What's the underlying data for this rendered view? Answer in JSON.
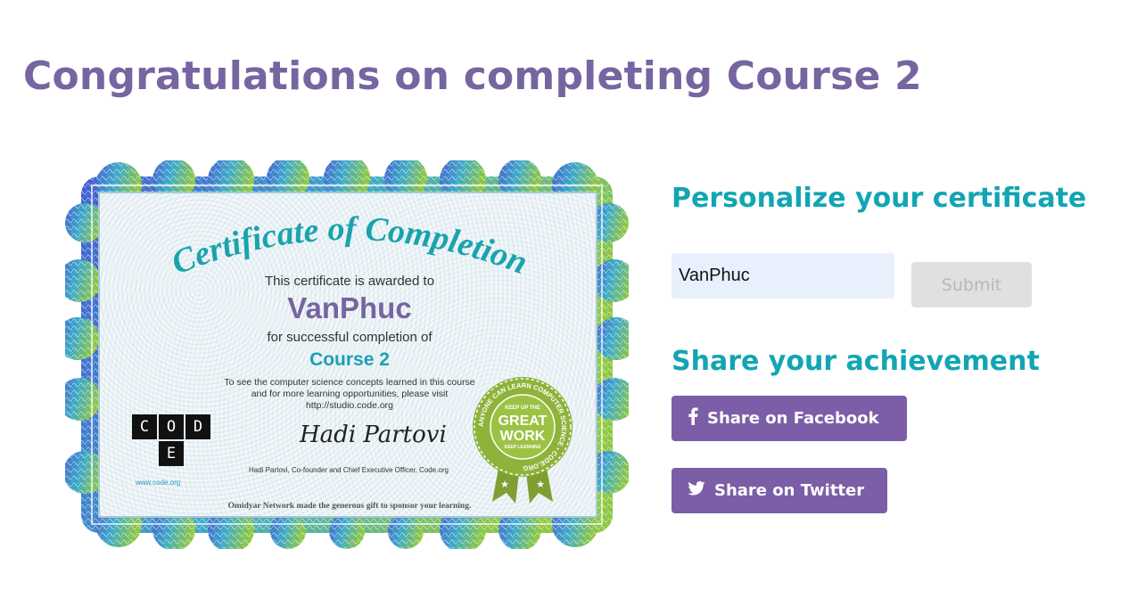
{
  "page": {
    "title": "Congratulations on completing Course 2"
  },
  "certificate": {
    "heading": "Certificate of Completion",
    "awarded_to": "This certificate is awarded to",
    "name": "VanPhuc",
    "completion_of": "for successful completion of",
    "course": "Course 2",
    "info_line_1": "To see the computer science concepts learned in this course",
    "info_line_2": "and for more learning opportunities, please visit",
    "info_line_3": "http://studio.code.org",
    "logo_letters": [
      "C",
      "O",
      "D",
      "E"
    ],
    "logo_url": "www.code.org",
    "signature": "Hadi Partovi",
    "signer": "Hadi Partovi, Co-founder and Chief Executive Officer, Code.org",
    "sponsor": "Omidyar Network made the generous gift to sponsor your learning.",
    "badge": {
      "ring_text": "ANYONE CAN LEARN COMPUTER SCIENCE • CODE.ORG",
      "top_text": "KEEP UP THE",
      "great": "GREAT",
      "work": "WORK",
      "bottom_text": "KEEP LEARNING"
    },
    "colors": {
      "frame_blue": "#3f5bd0",
      "frame_green": "#8cc63f",
      "heading": "#1aa3ad",
      "name": "#76659f",
      "course": "#1d9fb3",
      "badge": "#8db33a"
    }
  },
  "personalize": {
    "title": "Personalize your certificate",
    "input_value": "VanPhuc",
    "submit_label": "Submit"
  },
  "share": {
    "title": "Share your achievement",
    "facebook_label": "Share on Facebook",
    "twitter_label": "Share on Twitter",
    "facebook_icon": "facebook-icon",
    "twitter_icon": "twitter-icon"
  },
  "colors": {
    "page_title": "#7665a0",
    "section_title": "#12a5b3",
    "share_button": "#7b5ea7",
    "input_bg": "#e8f0fd",
    "submit_bg": "#e0e0e0"
  }
}
